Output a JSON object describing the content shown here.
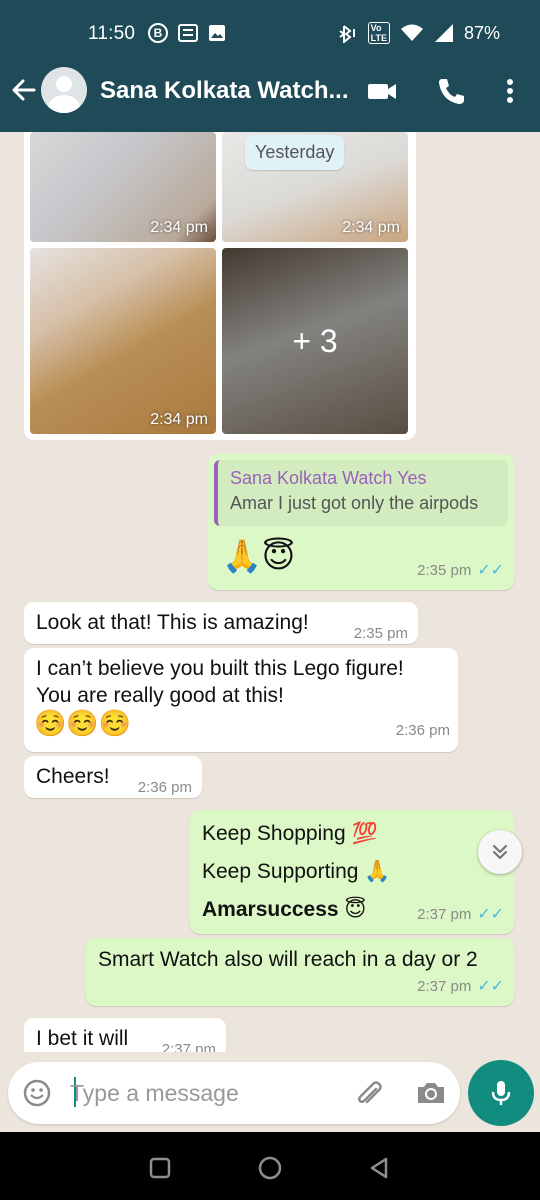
{
  "status_bar": {
    "time": "11:50",
    "battery": "87%"
  },
  "header": {
    "title": "Sana Kolkata Watch..."
  },
  "media": {
    "date_chip": "Yesterday",
    "photos": [
      {
        "time": "2:34 pm"
      },
      {
        "time": "2:34 pm"
      },
      {
        "time": "2:34 pm"
      },
      {
        "time": "",
        "more_label": "+ 3"
      }
    ]
  },
  "messages": [
    {
      "direction": "out",
      "quote_name": "Sana Kolkata Watch Yes",
      "quote_text": "Amar I just got only the airpods",
      "text": "🙏😇",
      "time": "2:35 pm"
    },
    {
      "direction": "in",
      "text": "Look at that! This is amazing!",
      "time": "2:35 pm"
    },
    {
      "direction": "in",
      "line1": "I can’t believe you built this Lego figure!",
      "line2": "You are really good at this!",
      "line3": "☺️☺️☺️",
      "time": "2:36 pm"
    },
    {
      "direction": "in",
      "text": "Cheers!",
      "time": "2:36 pm"
    },
    {
      "direction": "out",
      "line1": "Keep Shopping 💯",
      "line2": "Keep Supporting 🙏",
      "line3": "Amarsuccess 😇",
      "time": "2:37 pm"
    },
    {
      "direction": "out",
      "text": "Smart Watch also will reach in a day or 2",
      "time": "2:37 pm"
    },
    {
      "direction": "in",
      "text": "I bet it will",
      "time": "2:37 pm"
    }
  ],
  "composer": {
    "placeholder": "Type a message"
  },
  "colors": {
    "header": "#1f4a57",
    "outgoing_bubble": "#dcf8c6",
    "incoming_bubble": "#ffffff",
    "accent": "#128c7e",
    "read_ticks": "#4fb6ec"
  },
  "icons": [
    "back-arrow-icon",
    "video-call-icon",
    "phone-icon",
    "more-options-icon",
    "emoji-icon",
    "attach-icon",
    "camera-icon",
    "mic-icon",
    "chevron-double-down-icon"
  ]
}
